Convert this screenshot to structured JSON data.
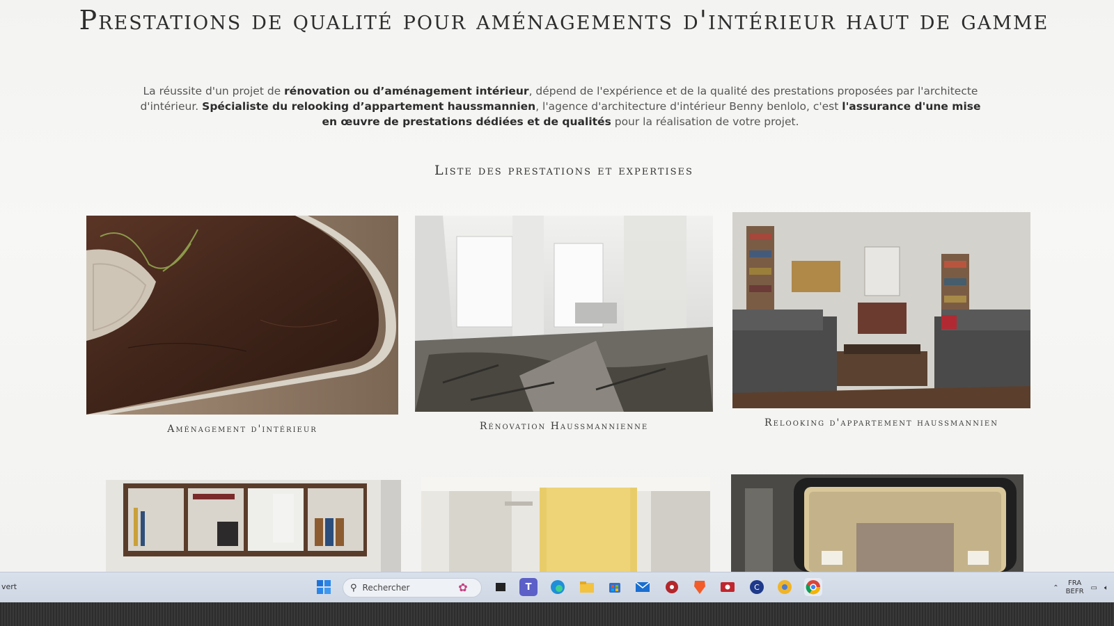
{
  "page": {
    "title": "Prestations de qualité pour aménagements d'intérieur haut de gamme",
    "intro": {
      "p1": "La réussite d'un projet de ",
      "b1": "rénovation ou d’aménagement intérieur",
      "p2": ", dépend de l'expérience et de la qualité des prestations proposées par l'architecte d'intérieur. ",
      "b2": "Spécialiste du relooking d’appartement haussmannien",
      "p3": ", l'agence d'architecture d'intérieur Benny benlolo, c'est ",
      "b3": "l'assurance d'une mise en œuvre de prestations dédiées et de qualités",
      "p4": " pour la réalisation de votre projet."
    },
    "subtitle": "Liste des prestations et expertises",
    "services": [
      {
        "caption": "Aménagement d'intérieur"
      },
      {
        "caption": "Rénovation Haussmannienne"
      },
      {
        "caption": "Relooking d'appartement haussmannien"
      }
    ]
  },
  "taskbar": {
    "status_text": "vert",
    "search_placeholder": "Rechercher",
    "lang_line1": "FRA",
    "lang_line2": "BEFR",
    "icons": [
      "start-icon",
      "search-icon",
      "widgets-icon",
      "task-view-icon",
      "teams-icon",
      "edge-icon",
      "file-explorer-icon",
      "store-icon",
      "mail-icon",
      "app-red-icon",
      "brave-icon",
      "recorder-icon",
      "ccleaner-icon",
      "chrome-canary-icon",
      "chrome-icon"
    ]
  },
  "colors": {
    "text_dark": "#2d2d2d",
    "taskbar": "#d3dbe7",
    "page_bg": "#f5f5f3"
  }
}
